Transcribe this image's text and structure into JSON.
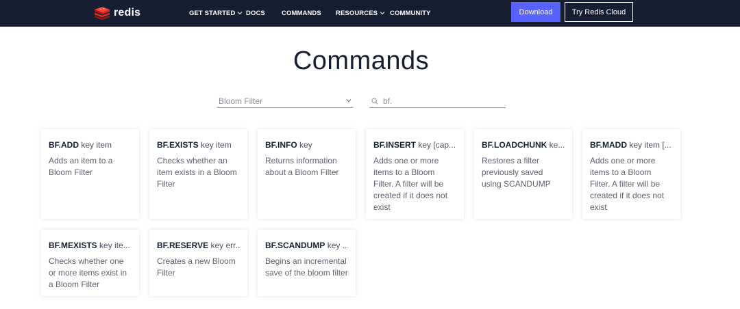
{
  "nav": {
    "logo_text": "redis",
    "items": [
      {
        "label": "GET STARTED",
        "dropdown": true
      },
      {
        "label": "DOCS",
        "dropdown": false
      },
      {
        "label": "COMMANDS",
        "dropdown": false
      },
      {
        "label": "RESOURCES",
        "dropdown": true
      },
      {
        "label": "COMMUNITY",
        "dropdown": false
      }
    ],
    "download_label": "Download",
    "cloud_label": "Try Redis Cloud"
  },
  "page": {
    "title": "Commands"
  },
  "filters": {
    "group_selected": "Bloom Filter",
    "search_value": "bf."
  },
  "commands": [
    {
      "name": "BF.ADD",
      "args": "key item",
      "desc": "Adds an item to a Bloom Filter"
    },
    {
      "name": "BF.EXISTS",
      "args": "key item",
      "desc": "Checks whether an item exists in a Bloom Filter"
    },
    {
      "name": "BF.INFO",
      "args": "key",
      "desc": "Returns information about a Bloom Filter"
    },
    {
      "name": "BF.INSERT",
      "args": "key [cap...",
      "desc": "Adds one or more items to a Bloom Filter. A filter will be created if it does not exist"
    },
    {
      "name": "BF.LOADCHUNK",
      "args": "ke...",
      "desc": "Restores a filter previously saved using SCANDUMP"
    },
    {
      "name": "BF.MADD",
      "args": "key item [...",
      "desc": "Adds one or more items to a Bloom Filter. A filter will be created if it does not exist"
    },
    {
      "name": "BF.MEXISTS",
      "args": "key ite...",
      "desc": "Checks whether one or more items exist in a Bloom Filter"
    },
    {
      "name": "BF.RESERVE",
      "args": "key err...",
      "desc": "Creates a new Bloom Filter"
    },
    {
      "name": "BF.SCANDUMP",
      "args": "key ...",
      "desc": "Begins an incremental save of the bloom filter"
    }
  ],
  "colors": {
    "navbar_bg": "#161f31",
    "accent": "#5961ff",
    "logo_red": "#dc382d"
  }
}
